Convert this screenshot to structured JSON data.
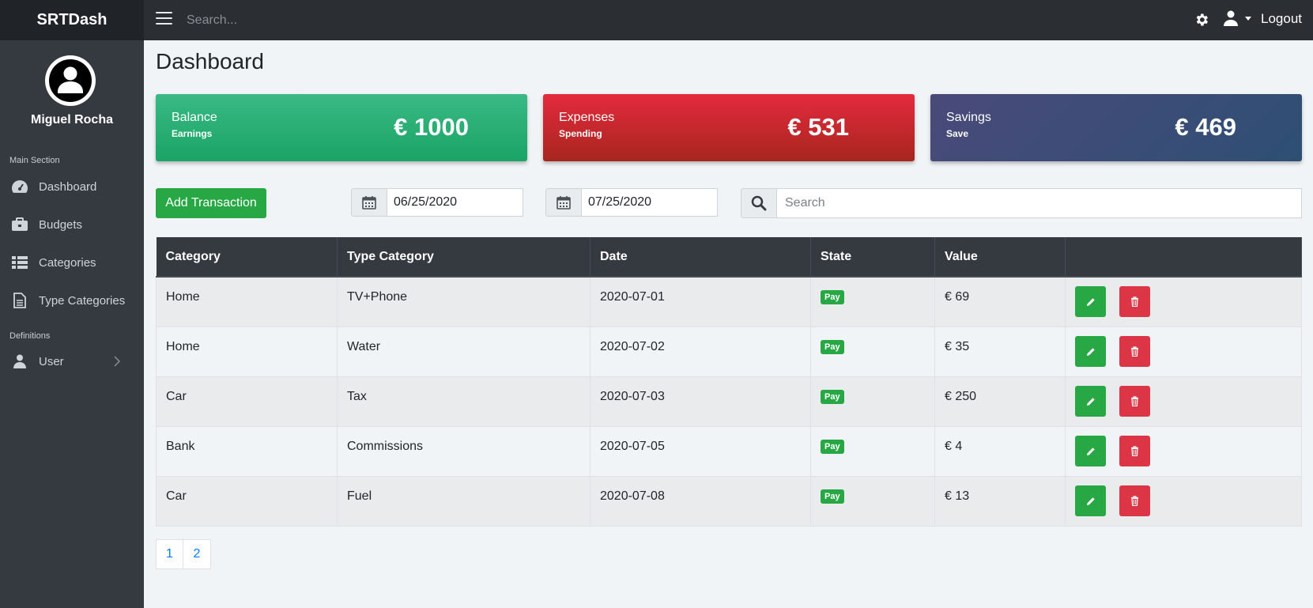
{
  "app": {
    "brand": "SRTDash"
  },
  "topbar": {
    "search_placeholder": "Search...",
    "logout_label": "Logout"
  },
  "sidebar": {
    "user_name": "Miguel Rocha",
    "main_section_title": "Main Section",
    "definitions_title": "Definitions",
    "items": [
      {
        "label": "Dashboard",
        "icon": "tachometer-icon"
      },
      {
        "label": "Budgets",
        "icon": "briefcase-icon"
      },
      {
        "label": "Categories",
        "icon": "list-icon"
      },
      {
        "label": "Type Categories",
        "icon": "file-icon"
      }
    ],
    "user_item": {
      "label": "User",
      "icon": "user-icon"
    }
  },
  "main": {
    "title": "Dashboard",
    "cards": {
      "balance": {
        "label": "Balance",
        "sub": "Earnings",
        "amount": "€ 1000",
        "color": "#1aa465"
      },
      "expenses": {
        "label": "Expenses",
        "sub": "Spending",
        "amount": "€ 531",
        "color": "#a7261e"
      },
      "savings": {
        "label": "Savings",
        "sub": "Save",
        "amount": "€ 469",
        "color": "#2e4f74"
      }
    },
    "add_button": "Add Transaction",
    "date_from": "06/25/2020",
    "date_to": "07/25/2020",
    "search_placeholder": "Search"
  },
  "table": {
    "headers": [
      "Category",
      "Type Category",
      "Date",
      "State",
      "Value",
      ""
    ],
    "rows": [
      {
        "category": "Home",
        "type": "TV+Phone",
        "date": "2020-07-01",
        "state": "Pay",
        "value": "€ 69"
      },
      {
        "category": "Home",
        "type": "Water",
        "date": "2020-07-02",
        "state": "Pay",
        "value": "€ 35"
      },
      {
        "category": "Car",
        "type": "Tax",
        "date": "2020-07-03",
        "state": "Pay",
        "value": "€ 250"
      },
      {
        "category": "Bank",
        "type": "Commissions",
        "date": "2020-07-05",
        "state": "Pay",
        "value": "€ 4"
      },
      {
        "category": "Car",
        "type": "Fuel",
        "date": "2020-07-08",
        "state": "Pay",
        "value": "€ 13"
      }
    ]
  },
  "pagination": {
    "pages": [
      "1",
      "2"
    ]
  }
}
